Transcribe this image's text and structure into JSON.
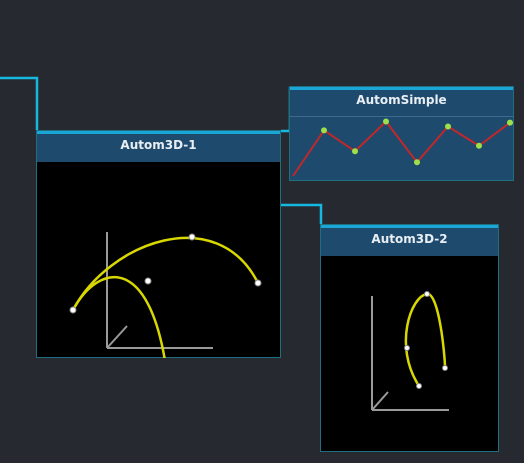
{
  "nodes": {
    "autom3d_1": {
      "title": "Autom3D-1"
    },
    "autom_simple": {
      "title": "AutomSimple",
      "values": [
        0.0,
        0.83,
        0.45,
        0.99,
        0.25,
        0.9,
        0.55,
        0.97
      ]
    },
    "autom3d_2": {
      "title": "Autom3D-2"
    }
  },
  "colors": {
    "background": "#262a30",
    "connection": "#15b8e0",
    "header": "#1e4a6e",
    "curve": "#d8d800",
    "point": "#9ee04a",
    "line": "#c0282a"
  }
}
